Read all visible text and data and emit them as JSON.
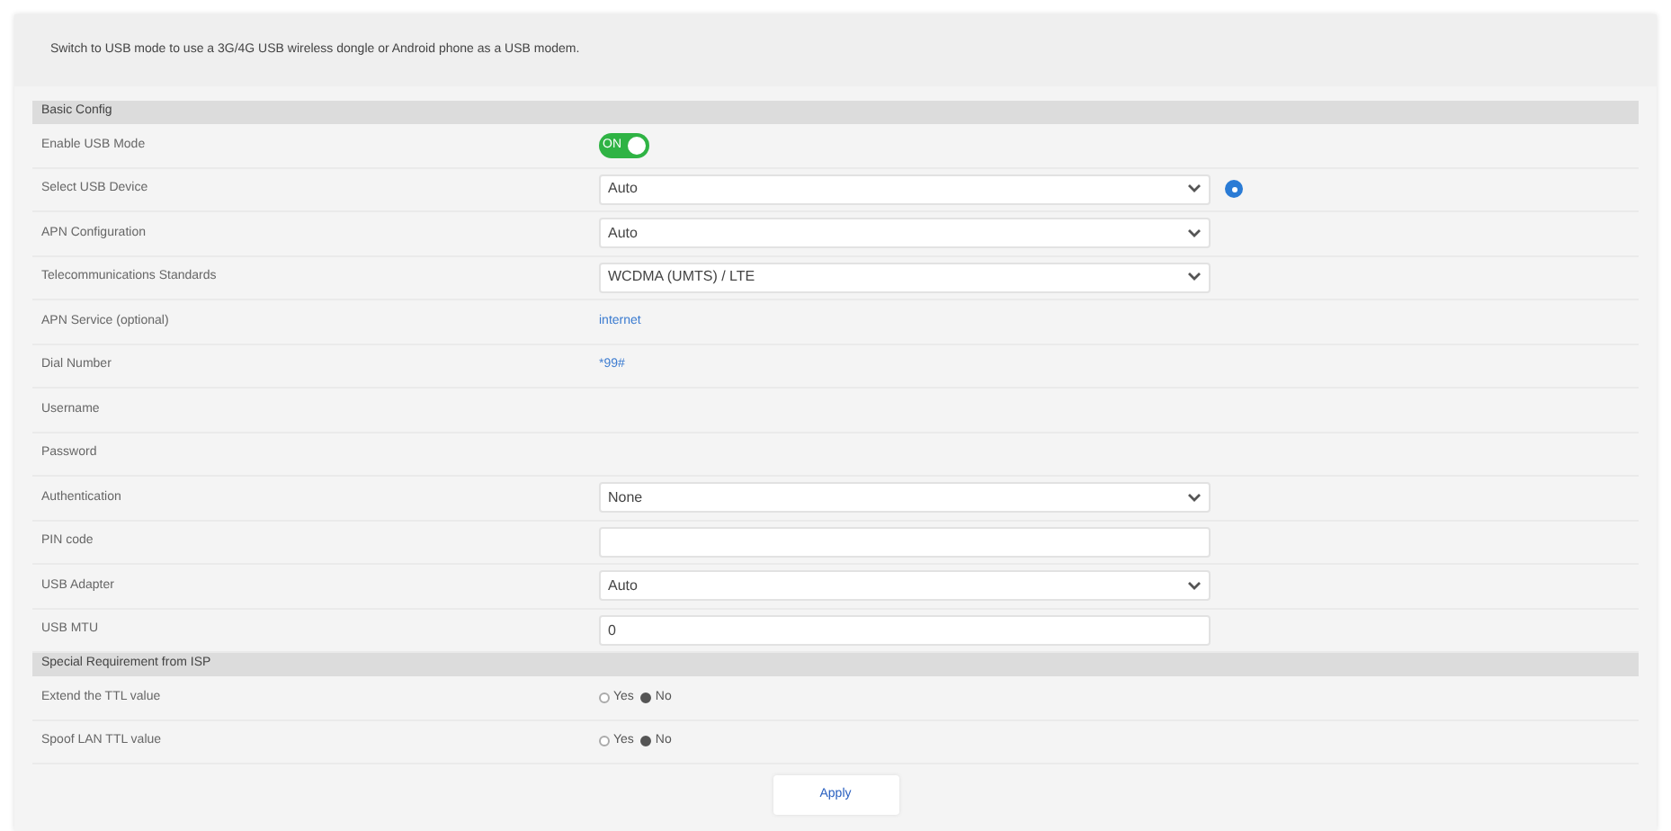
{
  "notice": "Switch to USB mode to use a 3G/4G USB wireless dongle or Android phone as a USB modem.",
  "sections": [
    {
      "title": "Basic Config",
      "rows": [
        {
          "label": "Enable USB Mode",
          "kind": "toggle",
          "on": true,
          "value": "ON"
        },
        {
          "label": "Select USB Device",
          "kind": "select",
          "value": "Auto",
          "help": true
        },
        {
          "label": "APN Configuration",
          "kind": "select",
          "value": "Auto"
        },
        {
          "label": "Telecommunications Standards",
          "kind": "select",
          "value": "WCDMA (UMTS) / LTE"
        },
        {
          "label": "APN Service (optional)",
          "kind": "text",
          "value": "internet"
        },
        {
          "label": "Dial Number",
          "kind": "text",
          "value": "*99#"
        },
        {
          "label": "Username",
          "kind": "empty"
        },
        {
          "label": "Password",
          "kind": "empty"
        },
        {
          "label": "Authentication",
          "kind": "select",
          "value": "None"
        },
        {
          "label": "PIN code",
          "kind": "input"
        },
        {
          "label": "USB Adapter",
          "kind": "select",
          "value": "Auto"
        },
        {
          "label": "USB MTU",
          "kind": "input",
          "value": "0"
        }
      ]
    },
    {
      "title": "Special Requirement from ISP",
      "rows": [
        {
          "label": "Extend the TTL value",
          "kind": "radio",
          "options": [
            {
              "label": "Yes",
              "selected": false
            },
            {
              "label": "No",
              "selected": true
            }
          ]
        },
        {
          "label": "Spoof LAN TTL value",
          "kind": "radio",
          "options": [
            {
              "label": "Yes",
              "selected": false
            },
            {
              "label": "No",
              "selected": true
            }
          ]
        }
      ]
    }
  ],
  "apply": "Apply"
}
